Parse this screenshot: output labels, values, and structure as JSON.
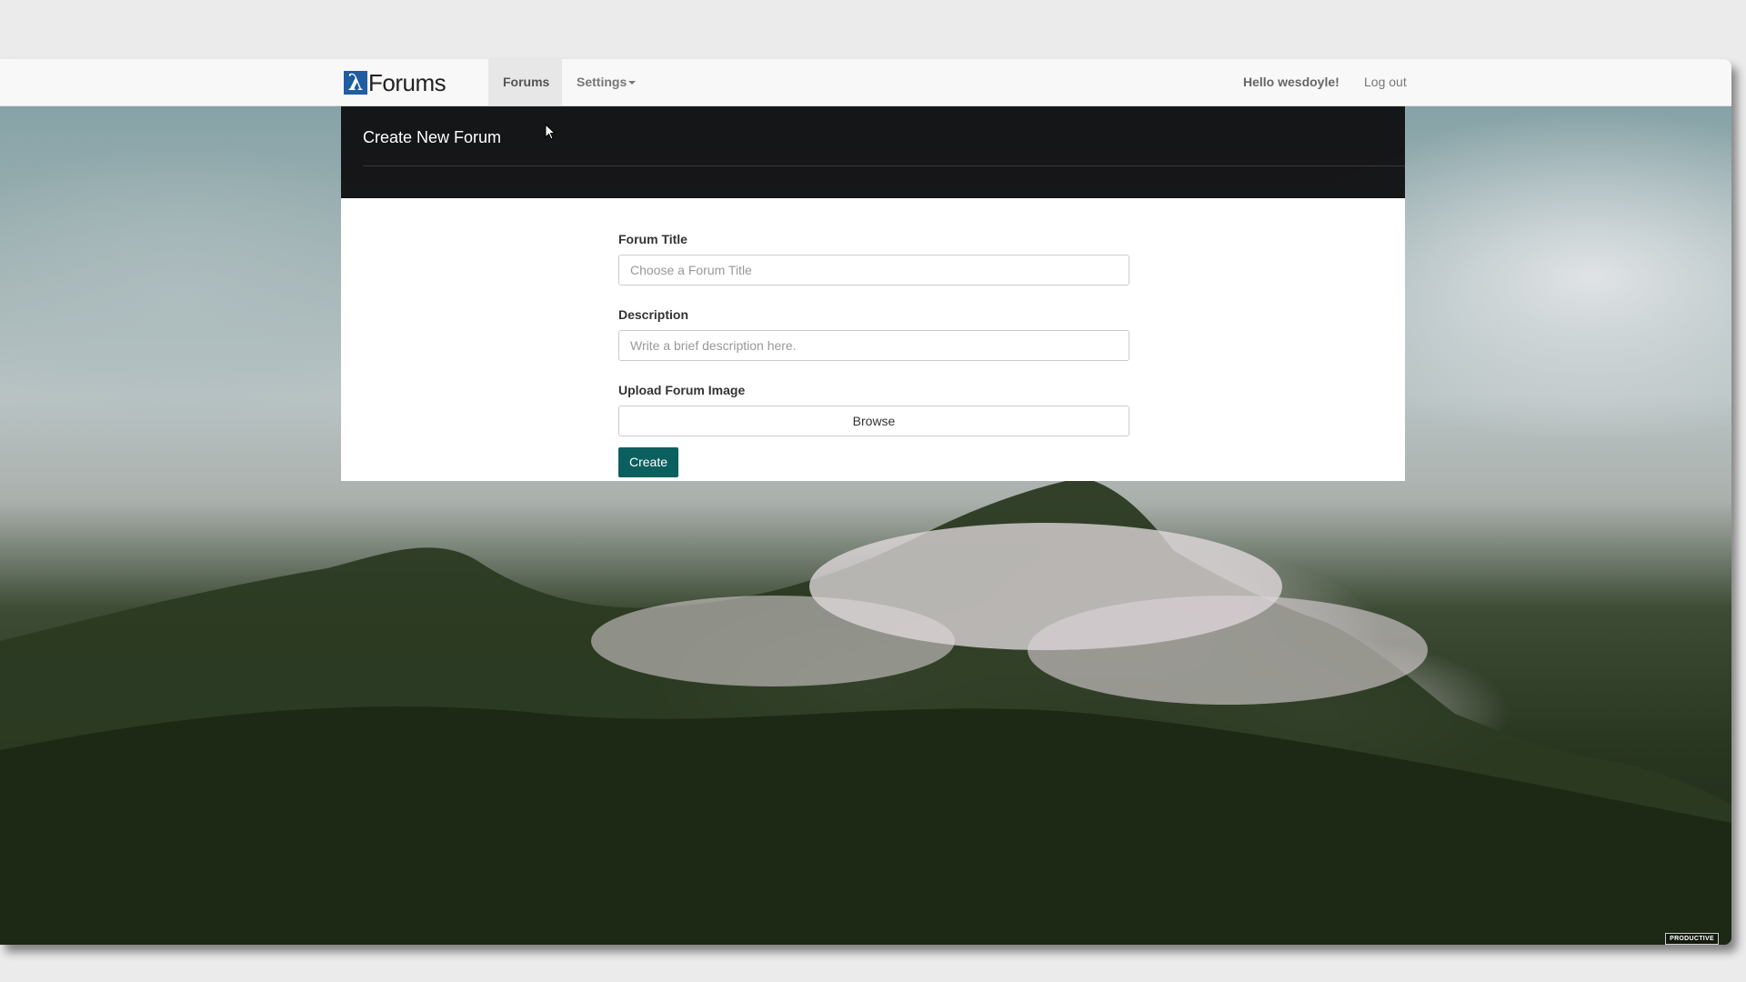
{
  "navbar": {
    "brand_symbol": "λ",
    "brand_text": "Forums",
    "forums_label": "Forums",
    "settings_label": "Settings",
    "greeting": "Hello wesdoyle!",
    "logout_label": "Log out"
  },
  "panel": {
    "title": "Create New Forum"
  },
  "form": {
    "title_label": "Forum Title",
    "title_placeholder": "Choose a Forum Title",
    "description_label": "Description",
    "description_placeholder": "Write a brief description here.",
    "image_label": "Upload Forum Image",
    "browse_label": "Browse",
    "create_label": "Create"
  },
  "footer": {
    "badge": "PRODUCTIVE"
  },
  "colors": {
    "create_button": "#0b5f5f",
    "header_bg": "#121214",
    "brand_logo": "#1e5d9f"
  },
  "icons": {
    "settings_caret": "caret-down-icon",
    "cursor": "mouse-pointer-icon"
  }
}
